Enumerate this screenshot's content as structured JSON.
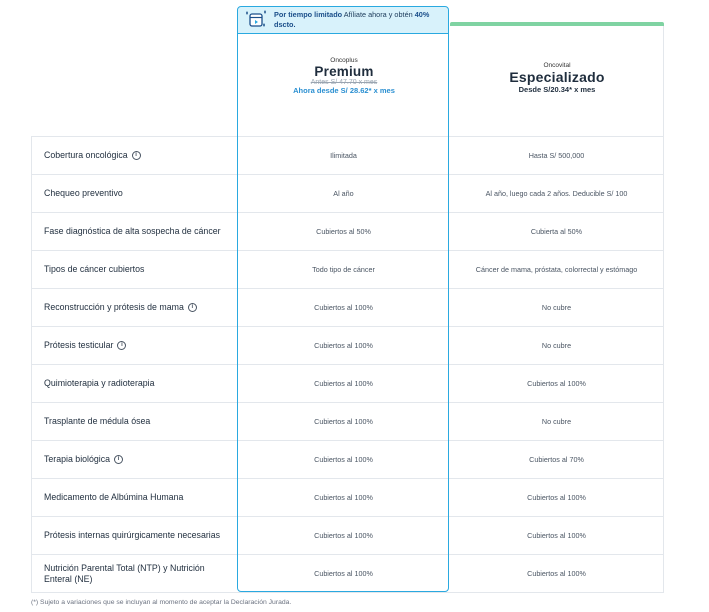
{
  "promo": {
    "highlight": "Por tiempo limitado",
    "rest": " Afíliate ahora y obtén ",
    "discount": "40% dscto."
  },
  "plans": {
    "premium": {
      "brand": "Oncoplus",
      "name": "Premium",
      "old_price": "Antes S/ 47.70 x mes",
      "price": "Ahora desde S/ 28.62* x mes"
    },
    "specialized": {
      "brand": "Oncovital",
      "name": "Especializado",
      "price": "Desde S/20.34* x mes"
    }
  },
  "rows": [
    {
      "label": "Cobertura oncológica",
      "info": true,
      "premium": "Ilimitada",
      "specialized": "Hasta S/ 500,000"
    },
    {
      "label": "Chequeo preventivo",
      "info": false,
      "premium": "Al año",
      "specialized": "Al año, luego cada 2 años. Deducible S/ 100"
    },
    {
      "label": "Fase diagnóstica de alta sospecha de cáncer",
      "info": false,
      "premium": "Cubiertos al 50%",
      "specialized": "Cubierta al 50%"
    },
    {
      "label": "Tipos de cáncer cubiertos",
      "info": false,
      "premium": "Todo tipo de cáncer",
      "specialized": "Cáncer de mama, próstata, colorrectal y estómago"
    },
    {
      "label": "Reconstrucción y prótesis de mama",
      "info": true,
      "premium": "Cubiertos al 100%",
      "specialized": "No cubre"
    },
    {
      "label": "Prótesis testicular",
      "info": true,
      "premium": "Cubiertos al 100%",
      "specialized": "No cubre"
    },
    {
      "label": "Quimioterapia y radioterapia",
      "info": false,
      "premium": "Cubiertos al 100%",
      "specialized": "Cubiertos al 100%"
    },
    {
      "label": "Trasplante de médula ósea",
      "info": false,
      "premium": "Cubiertos al 100%",
      "specialized": "No cubre"
    },
    {
      "label": "Terapia biológica",
      "info": true,
      "premium": "Cubiertos al 100%",
      "specialized": "Cubiertos al 70%"
    },
    {
      "label": "Medicamento de Albúmina Humana",
      "info": false,
      "premium": "Cubiertos al 100%",
      "specialized": "Cubiertos al 100%"
    },
    {
      "label": "Prótesis internas quirúrgicamente necesarias",
      "info": false,
      "premium": "Cubiertos al 100%",
      "specialized": "Cubiertos al 100%"
    },
    {
      "label": "Nutrición Parental Total (NTP) y Nutrición Enteral (NE)",
      "info": false,
      "premium": "Cubiertos al 100%",
      "specialized": "Cubiertos al 100%"
    }
  ],
  "footnote": "(*) Sujeto a variaciones que se incluyan al momento de aceptar la Declaración Jurada.",
  "colors": {
    "accent": "#2aa9e0",
    "promo_bg": "#d8f2fb",
    "specialized_top": "#7fd3a2",
    "price_link": "#2a8fd1"
  }
}
